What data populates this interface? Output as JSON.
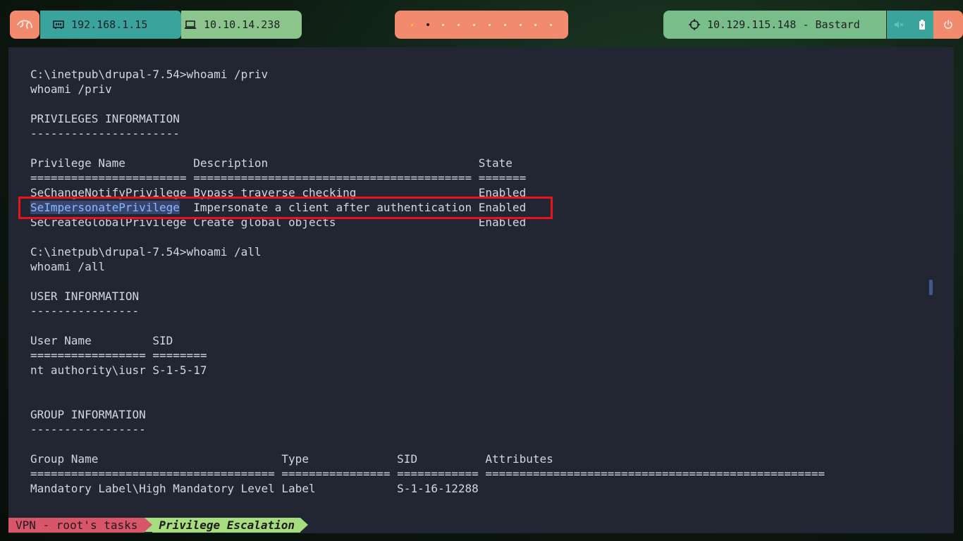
{
  "topbar": {
    "ip_local": "192.168.1.15",
    "ip_vpn": "10.10.14.238",
    "target": "10.129.115.148 - Bastard",
    "workspaces_count": 10,
    "active_workspace_index": 1,
    "current_workspace_index": 0
  },
  "terminal": {
    "lines": [
      "C:\\inetpub\\drupal-7.54>whoami /priv",
      "whoami /priv",
      "",
      "PRIVILEGES INFORMATION",
      "----------------------",
      "",
      "Privilege Name          Description                               State",
      "======================= ========================================= =======",
      "SeChangeNotifyPrivilege Bypass traverse checking                  Enabled",
      "SeImpersonatePrivilege  Impersonate a client after authentication Enabled",
      "SeCreateGlobalPrivilege Create global objects                     Enabled",
      "",
      "C:\\inetpub\\drupal-7.54>whoami /all",
      "whoami /all",
      "",
      "USER INFORMATION",
      "----------------",
      "",
      "User Name         SID",
      "================= ========",
      "nt authority\\iusr S-1-5-17",
      "",
      "",
      "GROUP INFORMATION",
      "-----------------",
      "",
      "Group Name                           Type             SID          Attributes",
      "==================================== ================ ============ ==================================================",
      "Mandatory Label\\High Mandatory Level Label            S-1-16-12288"
    ],
    "selected_text": "SeImpersonatePrivilege",
    "selected_line_index": 9
  },
  "statusbar": {
    "session": "VPN - root's tasks",
    "window": "Privilege Escalation"
  },
  "colors": {
    "terminal_bg": "#222532",
    "terminal_fg": "#d2d6e3",
    "highlight_border": "#e8141a",
    "selection_bg": "#35466e",
    "pill_orange": "#f28b6e",
    "pill_teal": "#3aa39b",
    "pill_green": "#79bd8a"
  }
}
